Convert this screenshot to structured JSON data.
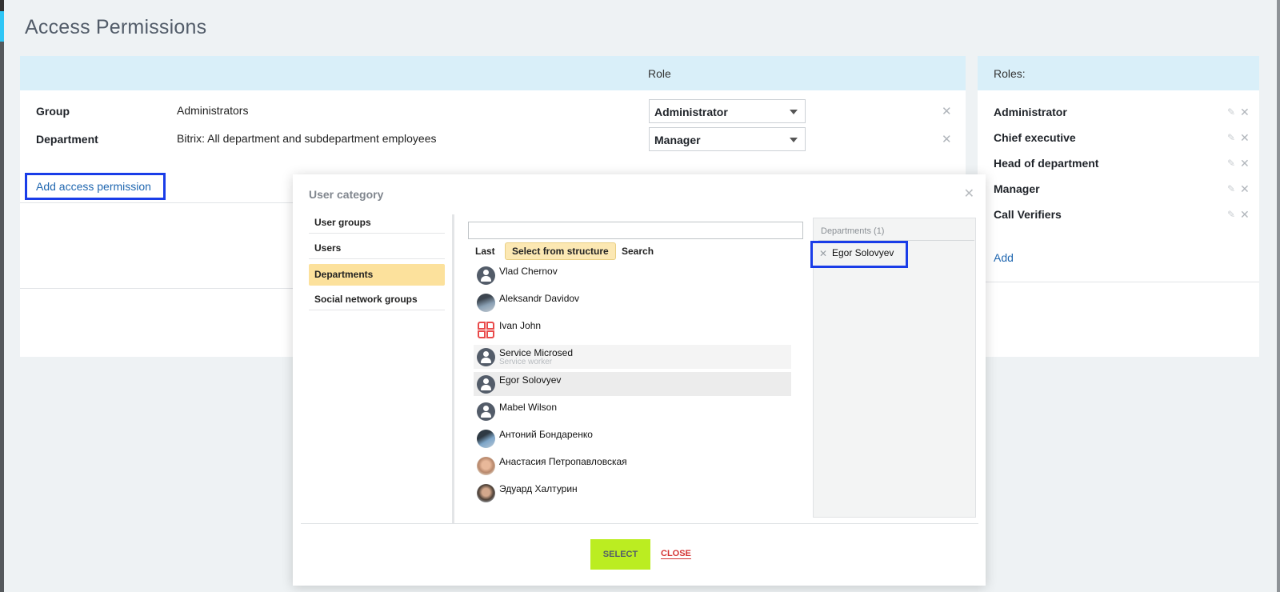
{
  "page": {
    "title": "Access Permissions"
  },
  "permissions": {
    "role_header": "Role",
    "rows": [
      {
        "type": "Group",
        "who": "Administrators",
        "role": "Administrator"
      },
      {
        "type": "Department",
        "who": "Bitrix: All department and subdepartment employees",
        "role": "Manager"
      }
    ],
    "add_link": "Add access permission"
  },
  "roles": {
    "header": "Roles:",
    "items": [
      "Administrator",
      "Chief executive",
      "Head of department",
      "Manager",
      "Call Verifiers"
    ],
    "add_link": "Add"
  },
  "dialog": {
    "title": "User category",
    "categories": [
      "User groups",
      "Users",
      "Departments",
      "Social network groups"
    ],
    "active_category": "Departments",
    "tabs": [
      "Last",
      "Select from structure",
      "Search"
    ],
    "active_tab": "Select from structure",
    "search_value": "",
    "users": [
      {
        "name": "Vlad Chernov",
        "subtitle": ""
      },
      {
        "name": "Aleksandr Davidov",
        "subtitle": ""
      },
      {
        "name": "Ivan John",
        "subtitle": ""
      },
      {
        "name": "Service Microsed",
        "subtitle": "Service worker"
      },
      {
        "name": "Egor Solovyev",
        "subtitle": ""
      },
      {
        "name": "Mabel Wilson",
        "subtitle": ""
      },
      {
        "name": "Антоний Бондаренко",
        "subtitle": ""
      },
      {
        "name": "Анастасия Петропавловская",
        "subtitle": ""
      },
      {
        "name": "Эдуард Халтурин",
        "subtitle": ""
      }
    ],
    "selected_header": "Departments (1)",
    "selected_items": [
      "Egor Solovyev"
    ],
    "select_button": "SELECT",
    "close_button": "CLOSE"
  },
  "colors": {
    "accent_blue": "#2fc6f6",
    "header_bg": "#d9eff9",
    "link": "#2067b0",
    "highlight_border": "#1a3de8",
    "active_category": "#fce19c",
    "select_button": "#bbed21",
    "close_text": "#d43535"
  }
}
